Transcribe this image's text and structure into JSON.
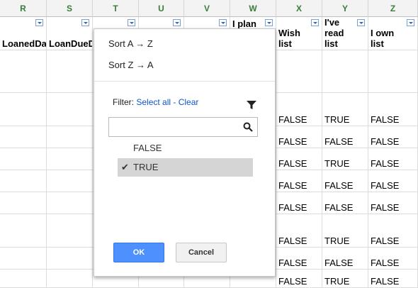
{
  "columns": [
    "R",
    "S",
    "T",
    "U",
    "V",
    "W",
    "X",
    "Y",
    "Z"
  ],
  "headers": {
    "R": "LoanedDa",
    "S": "LoanDueD",
    "W": "I plan",
    "X": "Wish\nlist",
    "Y": "I've\nread\nlist",
    "Z": "I own\nlist"
  },
  "rows": [
    {
      "X": "",
      "Y": "",
      "Z": ""
    },
    {
      "X": "FALSE",
      "Y": "TRUE",
      "Z": "FALSE"
    },
    {
      "X": "FALSE",
      "Y": "FALSE",
      "Z": "FALSE"
    },
    {
      "X": "FALSE",
      "Y": "TRUE",
      "Z": "FALSE"
    },
    {
      "X": "FALSE",
      "Y": "FALSE",
      "Z": "FALSE"
    },
    {
      "X": "FALSE",
      "Y": "FALSE",
      "Z": "FALSE"
    },
    {
      "X": "FALSE",
      "Y": "TRUE",
      "Z": "FALSE"
    },
    {
      "X": "FALSE",
      "Y": "FALSE",
      "Z": "FALSE"
    },
    {
      "X": "FALSE",
      "Y": "TRUE",
      "Z": "FALSE"
    }
  ],
  "menu": {
    "sort_asc": "Sort A → Z",
    "sort_desc": "Sort Z → A",
    "filter_label": "Filter:",
    "select_all": "Select all",
    "separator": " - ",
    "clear": "Clear",
    "search_value": "",
    "options": [
      {
        "label": "FALSE",
        "checked": false,
        "mark": ""
      },
      {
        "label": "TRUE",
        "checked": true,
        "mark": "✔"
      }
    ],
    "ok_label": "OK",
    "cancel_label": "Cancel"
  },
  "colors": {
    "column_letter": "#3a7d3a",
    "ok_button": "#4d90fe",
    "link": "#1155cc",
    "selected_option": "#d5d5d5"
  }
}
